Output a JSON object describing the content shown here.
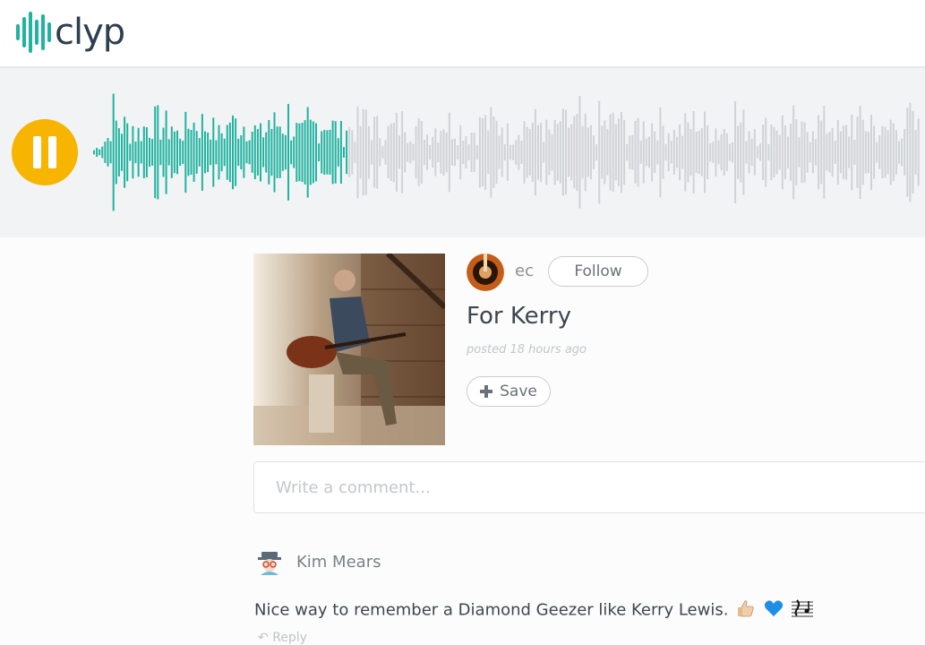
{
  "header": {
    "logo_text": "clyp"
  },
  "player": {
    "state": "playing",
    "progress": 0.31,
    "played_color": "#21b3a0",
    "unplayed_color": "#cfd3d6",
    "button_color": "#f7b400"
  },
  "track": {
    "username": "ec",
    "follow_label": "Follow",
    "title": "For Kerry",
    "posted": "posted 18 hours ago",
    "save_label": "Save"
  },
  "comment_input": {
    "placeholder": "Write a comment..."
  },
  "comments": [
    {
      "author": "Kim Mears",
      "text": "Nice way to remember a Diamond Geezer like Kerry Lewis.",
      "emojis": [
        "thumbs-up-icon",
        "blue-heart-icon",
        "musical-score-icon"
      ],
      "reply_label": "Reply"
    }
  ]
}
